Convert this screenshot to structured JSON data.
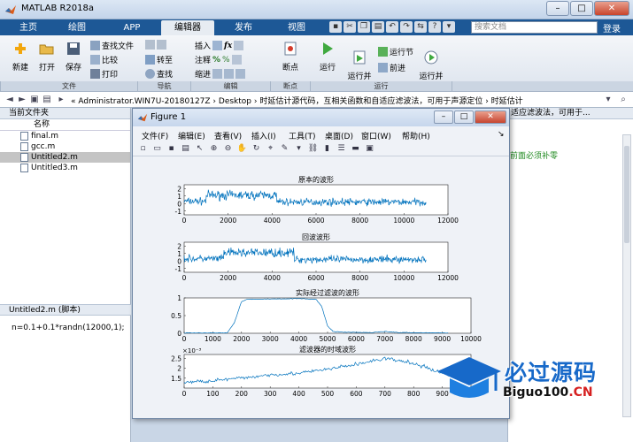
{
  "app": {
    "title": "MATLAB R2018a"
  },
  "window_buttons": {
    "minimize": "–",
    "maximize": "□",
    "close": "✕"
  },
  "tabs": [
    {
      "label": "主页",
      "active": false
    },
    {
      "label": "绘图",
      "active": false
    },
    {
      "label": "APP",
      "active": false
    },
    {
      "label": "编辑器",
      "active": true
    },
    {
      "label": "发布",
      "active": false
    },
    {
      "label": "视图",
      "active": false
    }
  ],
  "search": {
    "placeholder": "搜索文档"
  },
  "login": "登录",
  "ribbon": {
    "file_group": {
      "label": "文件",
      "new": "新建",
      "open": "打开",
      "save": "保存",
      "find_files": "查找文件",
      "compare": "比较",
      "print": "打印"
    },
    "nav_group": {
      "label": "导航",
      "goto": "转至",
      "find": "查找"
    },
    "edit_group": {
      "label": "编辑",
      "insert": "插入",
      "comment": "注释",
      "indent": "缩进"
    },
    "bp_group": {
      "label": "断点",
      "breakpoints": "断点"
    },
    "run_group": {
      "label": "运行",
      "run": "运行",
      "run_advance": "运行并\n前进",
      "run_section": "运行节",
      "advance": "前进",
      "run_time": "运行并\n计时"
    }
  },
  "address": {
    "path": "« Administrator.WIN7U-20180127Z  ›  Desktop  ›  时延估计源代码，互相关函数和自适应滤波法，可用于声源定位  ›  时延估计"
  },
  "current_folder": {
    "title": "当前文件夹",
    "column": "名称",
    "files": [
      {
        "name": "final.m",
        "selected": false
      },
      {
        "name": "gcc.m",
        "selected": false
      },
      {
        "name": "Untitled2.m",
        "selected": true
      },
      {
        "name": "Untitled3.m",
        "selected": false
      }
    ]
  },
  "details": {
    "header": "Untitled2.m  (脚本)",
    "code": "n=0.1+0.1*randn(12000,1);"
  },
  "editor": {
    "header": "适应滤波法，可用于...",
    "comment_fragment": "前面必须补零"
  },
  "figure": {
    "title": "Figure 1",
    "menu": [
      "文件(F)",
      "编辑(E)",
      "查看(V)",
      "插入(I)",
      "工具(T)",
      "桌面(D)",
      "窗口(W)",
      "帮助(H)"
    ]
  },
  "chart_data": [
    {
      "type": "line",
      "title": "原本的波形",
      "xlim": [
        0,
        12000
      ],
      "ylim": [
        -1.5,
        2.5
      ],
      "xticks": [
        0,
        2000,
        4000,
        6000,
        8000,
        10000,
        12000
      ],
      "yticks": [
        -1,
        0,
        1,
        2
      ],
      "series": [
        {
          "x_end": 11000,
          "segments": [
            {
              "x": [
                0,
                1000
              ],
              "mean": 0.3,
              "amp": 0.45
            },
            {
              "x": [
                1000,
                4200
              ],
              "mean": 1.1,
              "amp": 0.55
            },
            {
              "x": [
                4200,
                11000
              ],
              "mean": 0.2,
              "amp": 0.45
            }
          ]
        }
      ]
    },
    {
      "type": "line",
      "title": "回波波形",
      "xlim": [
        0,
        12000
      ],
      "ylim": [
        -1.5,
        2.5
      ],
      "xticks": [
        0,
        2000,
        4000,
        6000,
        8000,
        10000,
        12000
      ],
      "yticks": [
        -1,
        0,
        1,
        2
      ],
      "series": [
        {
          "x_end": 11000,
          "segments": [
            {
              "x": [
                0,
                1800
              ],
              "mean": 0.3,
              "amp": 0.45
            },
            {
              "x": [
                1800,
                5000
              ],
              "mean": 1.1,
              "amp": 0.55
            },
            {
              "x": [
                5000,
                11000
              ],
              "mean": 0.2,
              "amp": 0.45
            }
          ]
        }
      ]
    },
    {
      "type": "line",
      "title": "实际经过滤波的波形",
      "xlim": [
        0,
        10000
      ],
      "ylim": [
        0,
        1
      ],
      "xticks": [
        0,
        1000,
        2000,
        3000,
        4000,
        5000,
        6000,
        7000,
        8000,
        9000,
        10000
      ],
      "yticks": [
        0,
        0.5,
        1
      ],
      "series": [
        {
          "points": [
            [
              0,
              0.01
            ],
            [
              1500,
              0.01
            ],
            [
              1750,
              0.3
            ],
            [
              2000,
              0.9
            ],
            [
              2200,
              0.96
            ],
            [
              3000,
              0.97
            ],
            [
              4000,
              0.98
            ],
            [
              4600,
              0.96
            ],
            [
              4800,
              0.75
            ],
            [
              5000,
              0.2
            ],
            [
              5200,
              0.05
            ],
            [
              5500,
              0.03
            ],
            [
              6500,
              0.02
            ],
            [
              7000,
              0.05
            ],
            [
              7500,
              0.02
            ],
            [
              9200,
              0.01
            ]
          ]
        }
      ]
    },
    {
      "type": "line",
      "title": "滤波器的时域波形",
      "xlim": [
        0,
        1000
      ],
      "ylim": [
        0.001,
        0.0027
      ],
      "xticks": [
        0,
        100,
        200,
        300,
        400,
        500,
        600,
        700,
        800,
        900,
        1000
      ],
      "yticks": [
        0.0015,
        0.002,
        0.0025
      ],
      "ytick_labels": [
        "1.5",
        "2",
        "2.5"
      ],
      "yexponent": "×10⁻³",
      "series": [
        {
          "points": [
            [
              0,
              0.00128
            ],
            [
              100,
              0.00138
            ],
            [
              200,
              0.0015
            ],
            [
              300,
              0.00168
            ],
            [
              400,
              0.00175
            ],
            [
              500,
              0.00195
            ],
            [
              600,
              0.0022
            ],
            [
              700,
              0.0025
            ],
            [
              800,
              0.00225
            ],
            [
              900,
              0.00175
            ],
            [
              1000,
              0.0016
            ]
          ]
        }
      ]
    }
  ],
  "watermark": {
    "brand": "必过源码",
    "site": "Biguo100",
    "tld": ".CN"
  },
  "colors": {
    "line": "#0072bd",
    "tab_bar": "#1d5896",
    "comment": "#228b22"
  }
}
